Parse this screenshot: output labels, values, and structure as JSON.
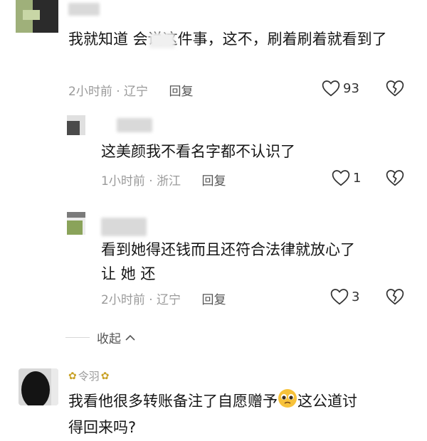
{
  "comments": [
    {
      "text": "我就知道    会说这件事，这不，刷着刷着就看到了",
      "time": "2小时前",
      "location": "辽宁",
      "reply_label": "回复",
      "likes": "93"
    },
    {
      "text": "这美颜我不看名字都不认识了",
      "time": "1小时前",
      "location": "浙江",
      "reply_label": "回复",
      "likes": "1"
    },
    {
      "text_line1": "看到她得还钱而且还符合法律就放心了",
      "text_line2": "让 她 还",
      "time": "2小时前",
      "location": "辽宁",
      "reply_label": "回复",
      "likes": "3"
    },
    {
      "username": "令羽",
      "text_part1": "我看他很多转账备注了自愿赠予",
      "text_part2": "这公道讨",
      "text_line2": "得回来吗?"
    }
  ],
  "collapse_label": "收起",
  "icons": {
    "heart": "heart-icon",
    "dislike": "broken-heart-icon",
    "collapse": "chevron-up-icon",
    "emoji": "pleading-face-emoji",
    "bee": "bee-emoji"
  },
  "colors": {
    "meta": "#9a9a9a",
    "text": "#161616"
  }
}
